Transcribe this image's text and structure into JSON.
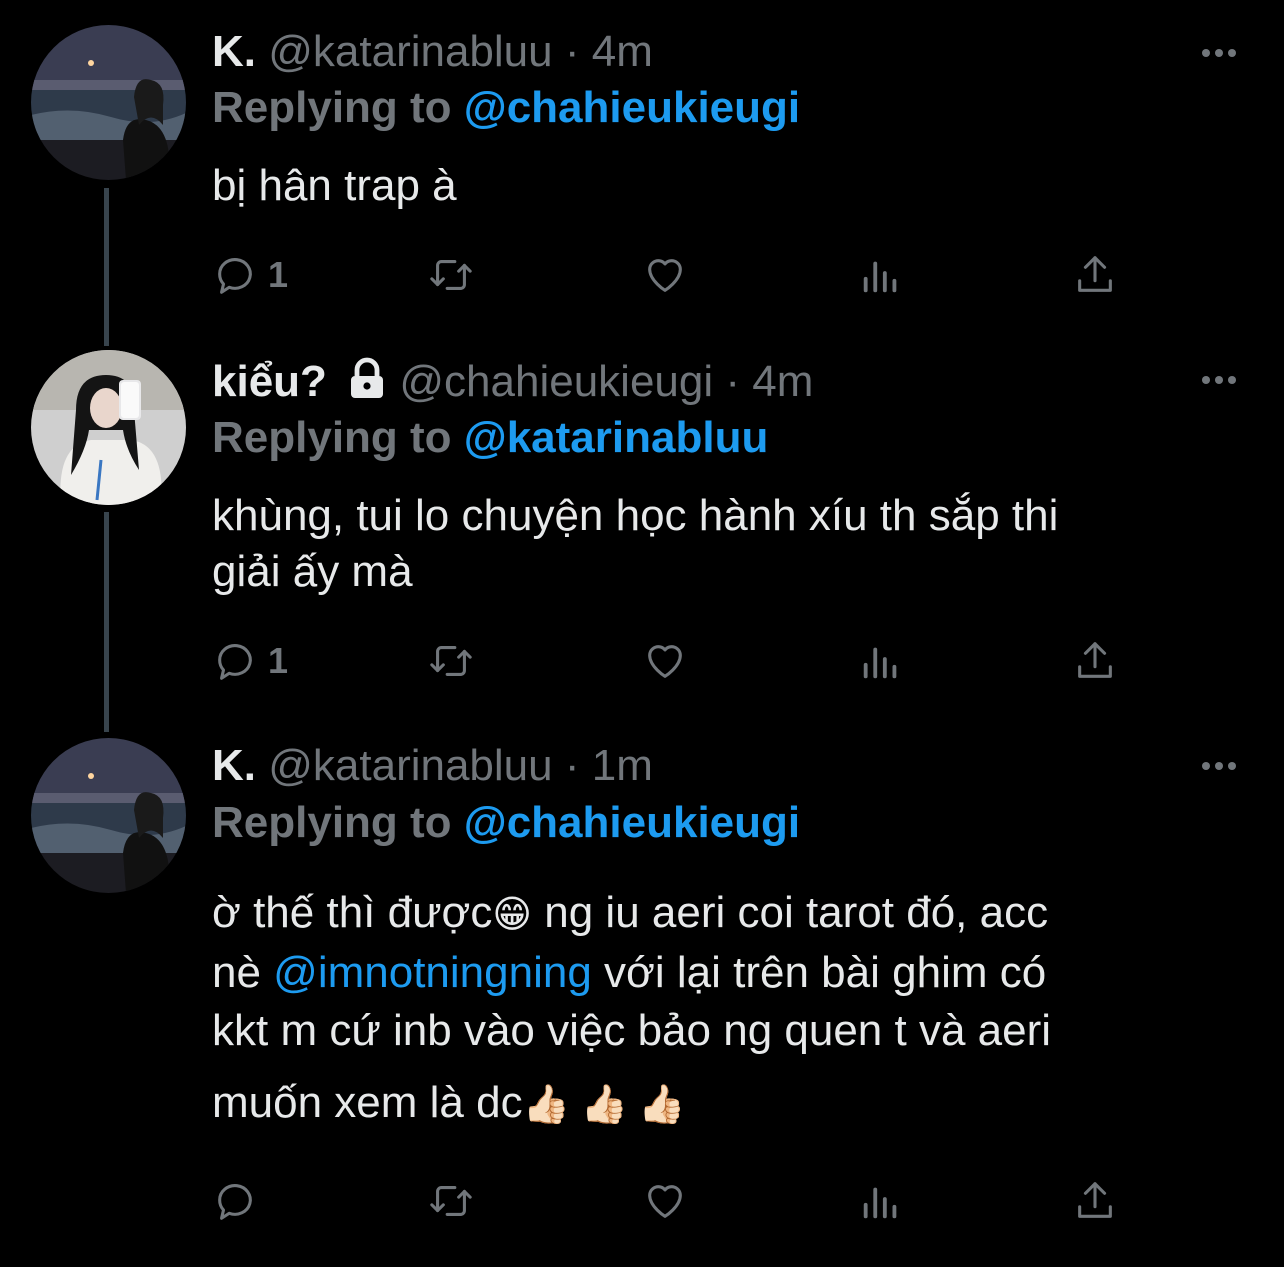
{
  "tweets": [
    {
      "name": "K.",
      "handle": "@katarinabluu",
      "separator": "·",
      "time": "4m",
      "replying_prefix": "Replying to",
      "replying_handle": "@chahieukieugi",
      "body_lines": [
        "bị hân trap à"
      ],
      "reply_count": "1",
      "avatar": "night-sea-selfie"
    },
    {
      "name": "kiểu?",
      "handle": "@chahieukieugi",
      "separator": "·",
      "time": "4m",
      "replying_prefix": "Replying to",
      "replying_handle": "@katarinabluu",
      "body_lines": [
        "khùng, tui lo chuyện học hành xíu th sắp thi",
        "giải ấy mà"
      ],
      "reply_count": "1",
      "avatar": "mirror-selfie"
    },
    {
      "name": "K.",
      "handle": "@katarinabluu",
      "separator": "·",
      "time": "1m",
      "replying_prefix": "Replying to",
      "replying_handle": "@chahieukieugi",
      "body": {
        "line1a": "ờ thế thì được",
        "emoji1": "😁",
        "line1b": " ng iu aeri coi tarot đó, acc",
        "line2a": "nè ",
        "mention": "@imnotningning",
        "line2b": " với lại trên bài ghim có",
        "line3": "kkt m cứ inb vào việc bảo ng quen t và aeri",
        "line4": "muốn xem là dc",
        "emoji_tail": "👍🏻 👍🏻 👍🏻"
      },
      "reply_count": "",
      "avatar": "night-sea-selfie"
    }
  ],
  "icons": [
    "reply-icon",
    "retweet-icon",
    "like-icon",
    "views-icon",
    "share-icon",
    "more-icon",
    "lock-icon"
  ],
  "colors": {
    "background": "#000000",
    "text": "#e7e9ea",
    "muted": "#71767b",
    "link": "#1d9bf0",
    "thread": "#38444d"
  }
}
